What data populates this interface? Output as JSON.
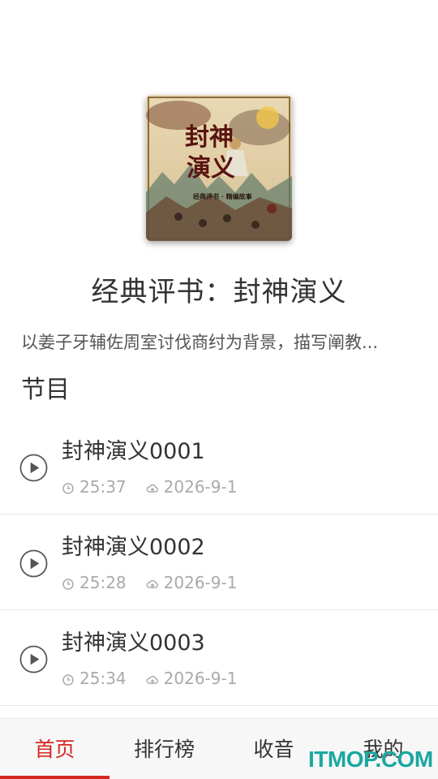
{
  "album": {
    "cover_title_line1": "封神",
    "cover_title_line2": "演义",
    "cover_subtitle": "经典评书 · 精编故事",
    "title": "经典评书：封神演义",
    "description": "以姜子牙辅佐周室讨伐商纣为背景，描写阐教..."
  },
  "section_title": "节目",
  "episodes": [
    {
      "title": "封神演义0001",
      "duration": "25:37",
      "date": "2026-9-1"
    },
    {
      "title": "封神演义0002",
      "duration": "25:28",
      "date": "2026-9-1"
    },
    {
      "title": "封神演义0003",
      "duration": "25:34",
      "date": "2026-9-1"
    }
  ],
  "tabs": [
    {
      "label": "首页",
      "active": true
    },
    {
      "label": "排行榜",
      "active": false
    },
    {
      "label": "收音",
      "active": false
    },
    {
      "label": "我的",
      "active": false
    }
  ],
  "watermark": "ITMOP.COM",
  "colors": {
    "accent": "#d6281f",
    "watermark": "#1aa7a0"
  }
}
